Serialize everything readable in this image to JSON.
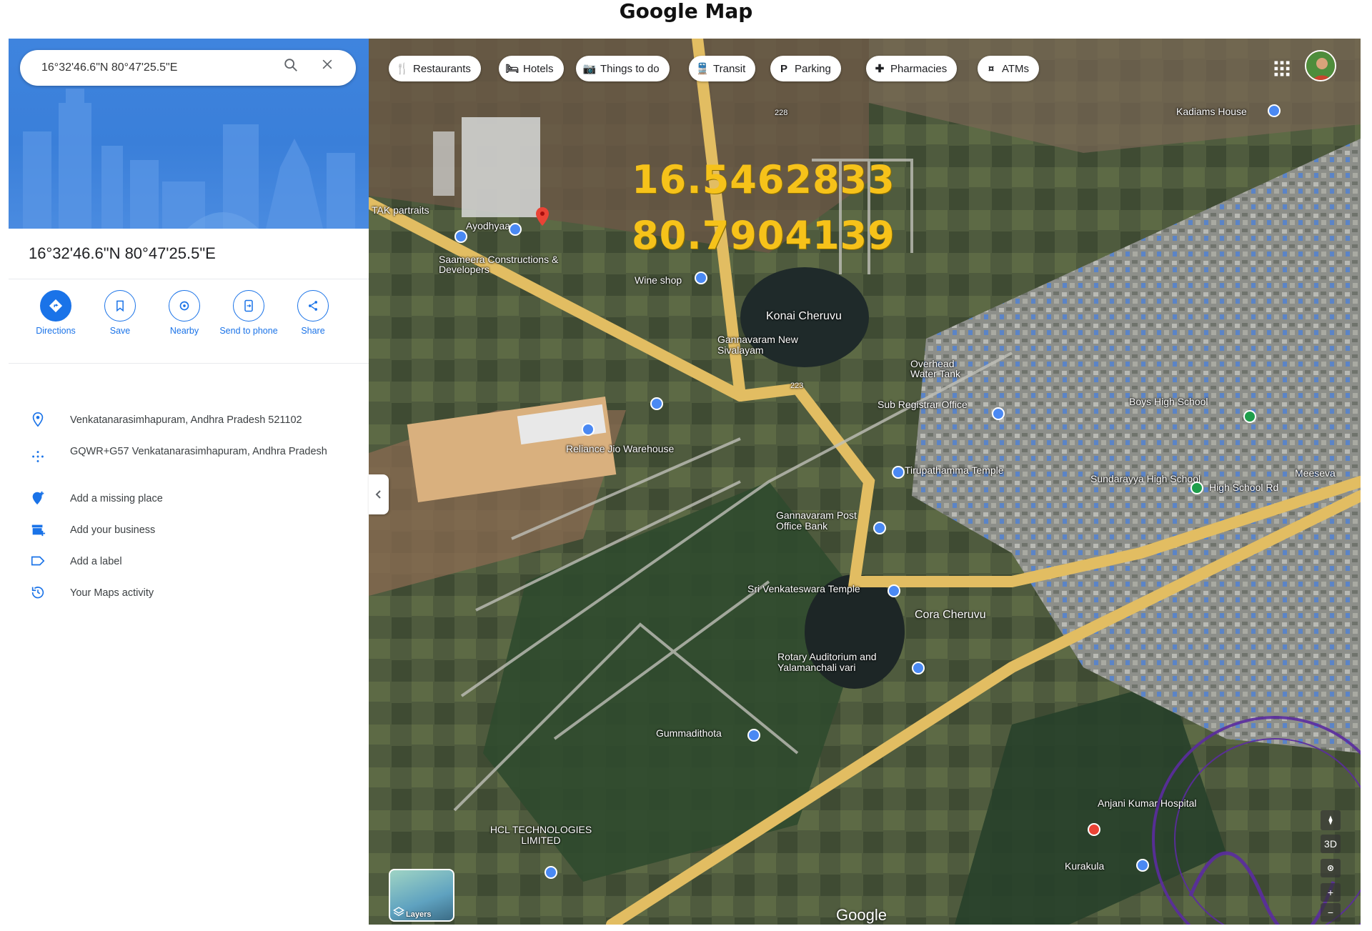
{
  "document_title": "Google Map",
  "search": {
    "value": "16°32'46.6\"N 80°47'25.5\"E",
    "placeholder": ""
  },
  "place": {
    "title": "16°32'46.6\"N 80°47'25.5\"E"
  },
  "actions": [
    {
      "label": "Directions",
      "icon": "directions-icon"
    },
    {
      "label": "Save",
      "icon": "bookmark-icon"
    },
    {
      "label": "Nearby",
      "icon": "nearby-icon"
    },
    {
      "label": "Send to phone",
      "icon": "send-to-phone-icon"
    },
    {
      "label": "Share",
      "icon": "share-icon"
    }
  ],
  "info": [
    {
      "text": "Venkatanarasimhapuram, Andhra Pradesh 521102",
      "icon": "location-pin-icon"
    },
    {
      "text": "GQWR+G57 Venkatanarasimhapuram, Andhra Pradesh",
      "icon": "plus-code-icon"
    },
    {
      "text": "Add a missing place",
      "icon": "add-place-icon"
    },
    {
      "text": "Add your business",
      "icon": "business-icon"
    },
    {
      "text": "Add a label",
      "icon": "label-icon"
    },
    {
      "text": "Your Maps activity",
      "icon": "history-icon"
    }
  ],
  "chips": [
    {
      "label": "Restaurants",
      "icon": "restaurant-icon"
    },
    {
      "label": "Hotels",
      "icon": "hotel-icon"
    },
    {
      "label": "Things to do",
      "icon": "camera-icon"
    },
    {
      "label": "Transit",
      "icon": "transit-icon"
    },
    {
      "label": "Parking",
      "icon": "parking-icon"
    },
    {
      "label": "Pharmacies",
      "icon": "pharmacy-icon"
    },
    {
      "label": "ATMs",
      "icon": "atm-icon"
    }
  ],
  "coordinates_overlay": {
    "lat": "16.5462833",
    "lng": "80.7904139"
  },
  "map_labels": [
    {
      "text": "Kadiams House"
    },
    {
      "text": "TAK partraits"
    },
    {
      "text": "Ayodhyaa"
    },
    {
      "text": "Saameera Constructions & Developers"
    },
    {
      "text": "Wine shop"
    },
    {
      "text": "Konai Cheruvu"
    },
    {
      "text": "Gannavaram New Sivalayam"
    },
    {
      "text": "Overhead Water Tank"
    },
    {
      "text": "Sub Registrar Office"
    },
    {
      "text": "Boys High School"
    },
    {
      "text": "Reliance Jio Warehouse"
    },
    {
      "text": "Tirupathamma Temple"
    },
    {
      "text": "Sundarayya High School"
    },
    {
      "text": "High School Rd"
    },
    {
      "text": "Meeseva"
    },
    {
      "text": "Gannavaram Post Office Bank"
    },
    {
      "text": "Sri Venkateswara Temple"
    },
    {
      "text": "Cora Cheruvu"
    },
    {
      "text": "Rotary Auditorium and Yalamanchali vari"
    },
    {
      "text": "Gummadithota"
    },
    {
      "text": "Anjani Kumar Hospital"
    },
    {
      "text": "HCL TECHNOLOGIES LIMITED"
    },
    {
      "text": "Kurakula"
    }
  ],
  "road_numbers": [
    "228",
    "223"
  ],
  "layers_label": "Layers",
  "google_logo": "Google",
  "map_controls": [
    "3D",
    "+",
    "−"
  ],
  "colors": {
    "accent": "#1a73e8",
    "hero_blue": "#3f84de",
    "coord_yellow": "#f6c21a",
    "road_yellow": "#e8c15a",
    "pin_red": "#ea4335",
    "stamp_purple": "#5b2ca0"
  }
}
